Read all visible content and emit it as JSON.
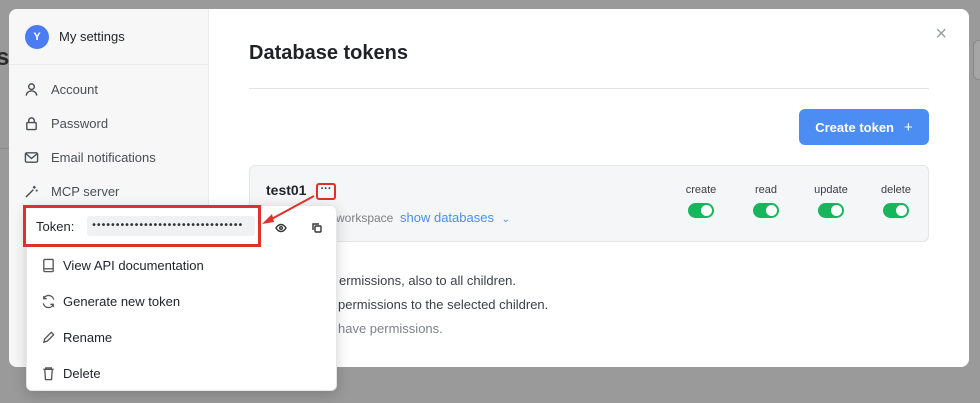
{
  "sidebar": {
    "avatar_letter": "Y",
    "title": "My settings",
    "items": [
      {
        "label": "Account",
        "icon": "user-icon"
      },
      {
        "label": "Password",
        "icon": "lock-icon"
      },
      {
        "label": "Email notifications",
        "icon": "mail-icon"
      },
      {
        "label": "MCP server",
        "icon": "magic-wand-icon"
      }
    ]
  },
  "main": {
    "title": "Database tokens",
    "close_label": "×",
    "create_button": {
      "label": "Create token",
      "icon": "+"
    }
  },
  "token": {
    "name": "test01",
    "menu_label": "···",
    "scope_label": "workspace",
    "show_databases": "show databases",
    "permissions": [
      {
        "label": "create",
        "enabled": true
      },
      {
        "label": "read",
        "enabled": true
      },
      {
        "label": "update",
        "enabled": true
      },
      {
        "label": "delete",
        "enabled": true
      }
    ]
  },
  "notes": [
    "ermissions, also to all children.",
    "permissions to the selected children.",
    "have permissions."
  ],
  "menu": {
    "token_label": "Token:",
    "token_value": "••••••••••••••••••••••••••••••••",
    "items": [
      {
        "label": "View API documentation",
        "icon": "book-icon"
      },
      {
        "label": "Generate new token",
        "icon": "refresh-icon"
      },
      {
        "label": "Rename",
        "icon": "pencil-icon"
      },
      {
        "label": "Delete",
        "icon": "trash-icon"
      }
    ]
  },
  "colors": {
    "accent": "#4c8df4",
    "toggle_on": "#17b55c",
    "highlight": "#e0302a"
  }
}
